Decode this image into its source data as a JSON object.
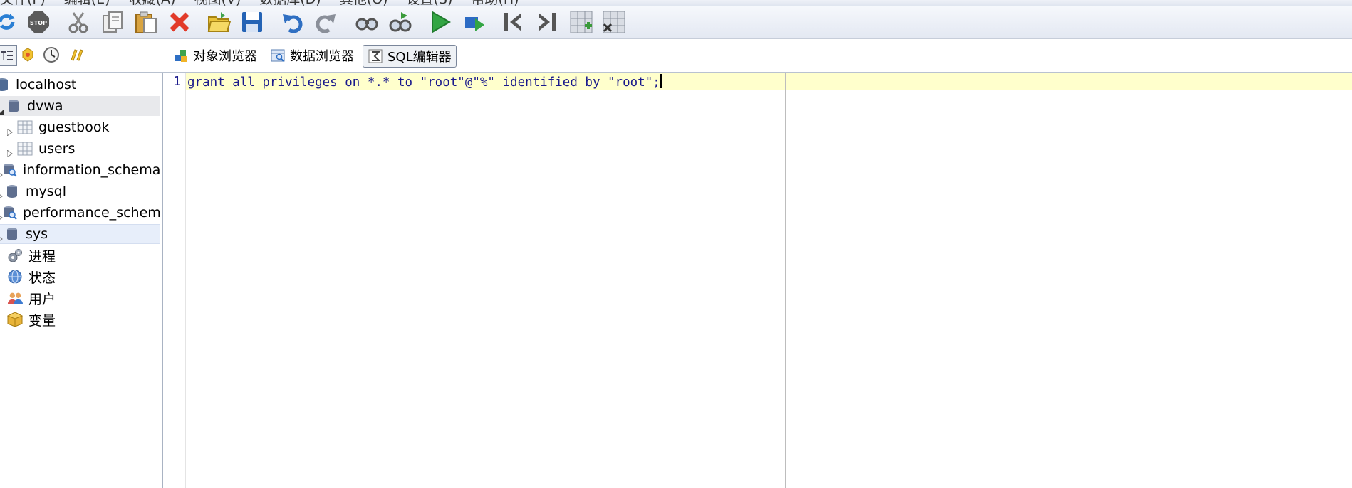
{
  "menubar": {
    "items": [
      "文件(F)",
      "编辑(E)",
      "收藏(A)",
      "视图(V)",
      "数据库(D)",
      "其他(O)",
      "设置(S)",
      "帮助(H)"
    ]
  },
  "toolbar": {
    "icons": [
      "refresh-icon",
      "stop-icon",
      "cut-icon",
      "copy-icon",
      "paste-icon",
      "delete-icon",
      "open-folder-icon",
      "save-icon",
      "undo-icon",
      "redo-icon",
      "find-icon",
      "find-next-icon",
      "execute-icon",
      "execute-selection-icon",
      "first-icon",
      "last-icon",
      "add-row-icon",
      "delete-row-icon"
    ]
  },
  "tabs": [
    {
      "label": "对象浏览器",
      "active": false
    },
    {
      "label": "数据浏览器",
      "active": false
    },
    {
      "label": "SQL编辑器",
      "active": true
    }
  ],
  "tree": {
    "root": "localhost",
    "items": [
      {
        "label": "dvwa",
        "type": "database",
        "expanded": true,
        "selected": true
      },
      {
        "label": "guestbook",
        "type": "table"
      },
      {
        "label": "users",
        "type": "table"
      },
      {
        "label": "information_schema",
        "type": "schema"
      },
      {
        "label": "mysql",
        "type": "database"
      },
      {
        "label": "performance_schema",
        "type": "schema"
      },
      {
        "label": "sys",
        "type": "database",
        "hover": true
      },
      {
        "label": "进程",
        "type": "process"
      },
      {
        "label": "状态",
        "type": "status"
      },
      {
        "label": "用户",
        "type": "users"
      },
      {
        "label": "变量",
        "type": "variables"
      }
    ]
  },
  "editor": {
    "line_number": "1",
    "code": "grant all privileges on *.* to \"root\"@\"%\" identified by \"root\";"
  }
}
